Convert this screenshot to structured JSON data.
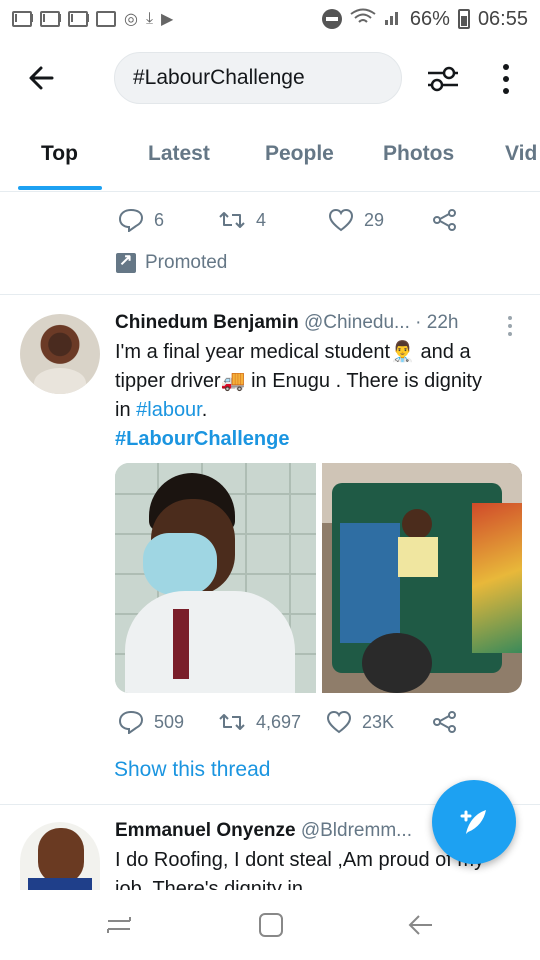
{
  "status_bar": {
    "battery": "66%",
    "time": "06:55",
    "left_icons": [
      "mail-icon",
      "mail-icon",
      "mail-icon",
      "image-icon",
      "camera-icon",
      "download-icon",
      "play-icon"
    ]
  },
  "header": {
    "back_icon": "arrow-left-icon",
    "search_value": "#LabourChallenge",
    "filter_icon": "sliders-icon",
    "more_icon": "more-vertical-icon"
  },
  "tabs": [
    {
      "label": "Top",
      "active": true
    },
    {
      "label": "Latest",
      "active": false
    },
    {
      "label": "People",
      "active": false
    },
    {
      "label": "Photos",
      "active": false
    },
    {
      "label": "Vid",
      "active": false
    }
  ],
  "promoted_tweet": {
    "replies": "6",
    "retweets": "4",
    "likes": "29",
    "promoted_label": "Promoted"
  },
  "tweet1": {
    "name": "Chinedum Benjamin",
    "handle": "@Chinedu...",
    "time": "· 22h",
    "text_line1": "I'm a final year medical student",
    "emoji1": "👨‍⚕️",
    "text_line1b": " and a",
    "text_line2": "tipper driver",
    "emoji2": "🚚",
    "text_line2b": " in Enugu . There is dignity",
    "text_line3": "in ",
    "hashtag1": "#labour",
    "text_line3b": ".",
    "hashtag2": "#LabourChallenge",
    "replies": "509",
    "retweets": "4,697",
    "likes": "23K",
    "show_thread": "Show this thread"
  },
  "tweet2": {
    "name": "Emmanuel Onyenze",
    "handle": "@Bldremm...",
    "text": "I do Roofing, I dont steal ,Am proud of my job. There's dignity in"
  },
  "colors": {
    "accent": "#1da1f2",
    "link": "#1b95e0",
    "muted": "#657786"
  }
}
